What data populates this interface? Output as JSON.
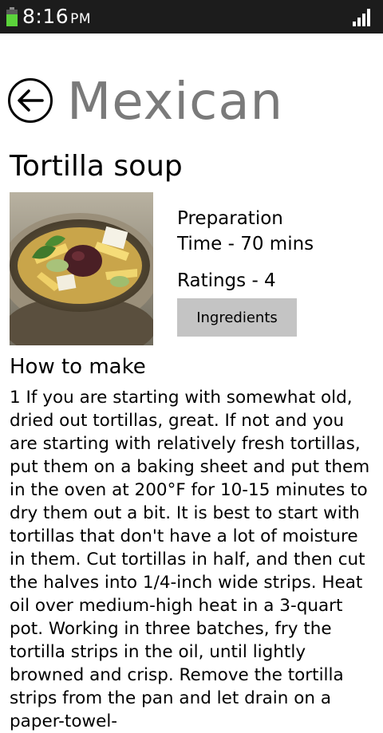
{
  "status_bar": {
    "time": "8:16",
    "ampm": "PM",
    "battery_icon": "battery-icon",
    "signal_icon": "signal-icon"
  },
  "header": {
    "back_icon": "back-arrow-icon",
    "title": "Mexican"
  },
  "recipe": {
    "title": "Tortilla soup",
    "image_alt": "tortilla-soup-photo",
    "preparation_line1": "Preparation",
    "preparation_line2": "Time - 70 mins",
    "ratings": "Ratings - 4",
    "ingredients_button": "Ingredients",
    "how_to_heading": "How to make",
    "instructions": "1 If you are starting with somewhat old, dried out tortillas, great. If not and you are starting with relatively fresh tortillas, put them on a baking sheet and put them in the oven at 200°F for 10-15 minutes to dry them out a bit. It is best to start with tortillas that don't have a lot of moisture in them. Cut tortillas in half, and then cut the halves into 1/4-inch wide strips. Heat oil over medium-high heat in a 3-quart pot. Working in three batches, fry the tortilla strips in the oil, until lightly browned and crisp. Remove the tortilla strips from the pan and let drain on a paper-towel-"
  },
  "colors": {
    "status_bar_bg": "#1c1c1c",
    "title_gray": "#7a7a7a",
    "button_bg": "#c4c4c4",
    "battery_green": "#5bd43b"
  }
}
